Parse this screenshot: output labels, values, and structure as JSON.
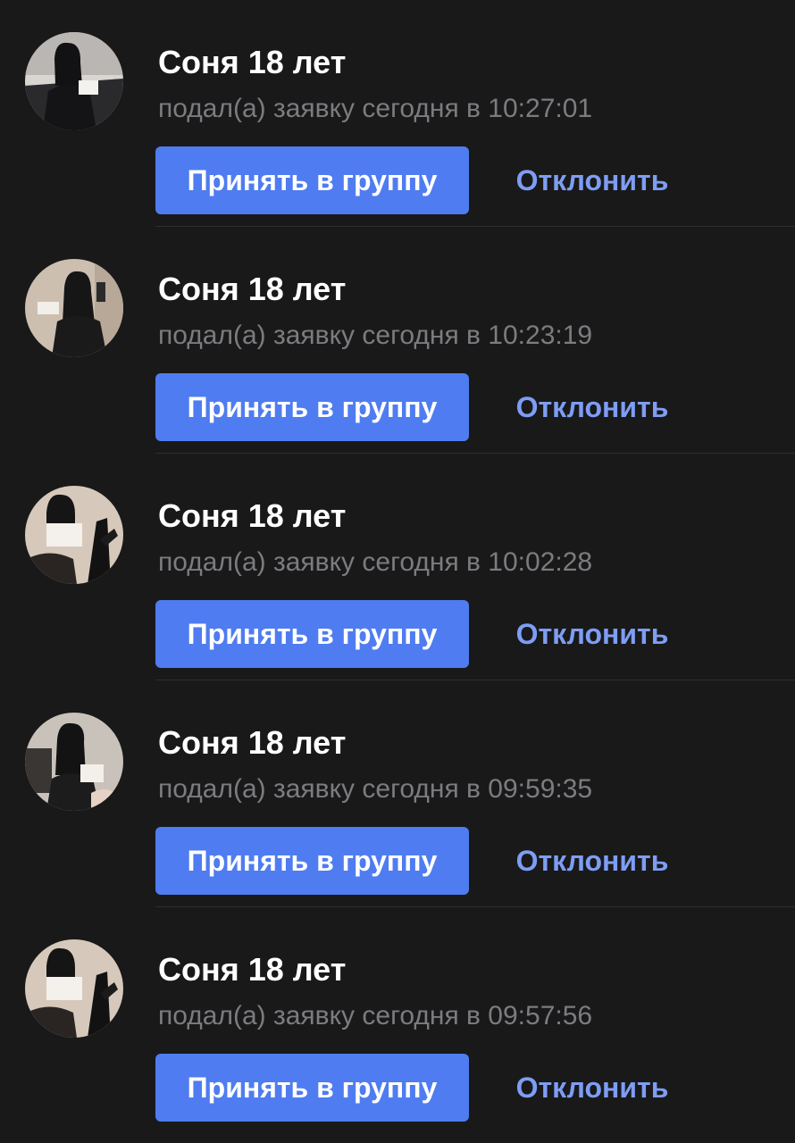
{
  "requests": [
    {
      "name": "Соня 18 лет",
      "subtitle": "подал(а) заявку сегодня в 10:27:01",
      "accept_label": "Принять в группу",
      "decline_label": "Отклонить"
    },
    {
      "name": "Соня 18 лет",
      "subtitle": "подал(а) заявку сегодня в 10:23:19",
      "accept_label": "Принять в группу",
      "decline_label": "Отклонить"
    },
    {
      "name": "Соня 18 лет",
      "subtitle": "подал(а) заявку сегодня в 10:02:28",
      "accept_label": "Принять в группу",
      "decline_label": "Отклонить"
    },
    {
      "name": "Соня 18 лет",
      "subtitle": "подал(а) заявку сегодня в 09:59:35",
      "accept_label": "Принять в группу",
      "decline_label": "Отклонить"
    },
    {
      "name": "Соня 18 лет",
      "subtitle": "подал(а) заявку сегодня в 09:57:56",
      "accept_label": "Принять в группу",
      "decline_label": "Отклонить"
    }
  ],
  "colors": {
    "background": "#19191a",
    "accent": "#4f7cf0",
    "decline_text": "#7e9df3",
    "secondary_text": "#7c7c80"
  }
}
